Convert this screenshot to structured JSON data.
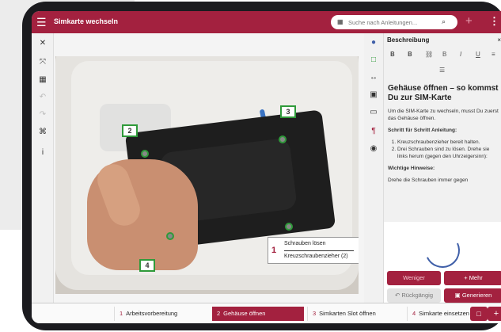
{
  "topbar": {
    "title": "Simkarte wechseln",
    "search_placeholder": "Suche nach Anleitungen..."
  },
  "photo_labels": {
    "c1": "2",
    "c2": "3",
    "c3": "4"
  },
  "step_box": {
    "number": "1",
    "line1": "Schrauben lösen",
    "line2": "Kreuzschraubenzieher (2)"
  },
  "panel": {
    "header": "Beschreibung",
    "heading": "Gehäuse öffnen – so kommst Du zur SIM-Karte",
    "intro": "Um die SIM-Karte zu wechseln, musst Du zuerst das Gehäuse öffnen.",
    "steps_title": "Schritt für Schritt Anleitung:",
    "steps": [
      "Kreuzschraubenzieher bereit halten.",
      "Drei Schrauben sind zu lösen. Drehe sie links herum (gegen den Uhrzeigersinn):"
    ],
    "hints_title": "Wichtige Hinweise:",
    "hint_cut": "Drehe die Schrauben immer gegen"
  },
  "buttons": {
    "less": "Weniger",
    "more": "Mehr",
    "undo": "Rückgängig",
    "generate": "Generieren"
  },
  "bottom_steps": [
    {
      "num": "1",
      "label": "Arbeitsvorbereitung"
    },
    {
      "num": "2",
      "label": "Gehäuse öffnen"
    },
    {
      "num": "3",
      "label": "Simkarten Slot öffnen"
    },
    {
      "num": "4",
      "label": "Simkarte einsetzen"
    }
  ],
  "colors": {
    "brand": "#a3213f",
    "accent_green": "#2f9a3a",
    "accent_blue": "#3f5fa8"
  }
}
